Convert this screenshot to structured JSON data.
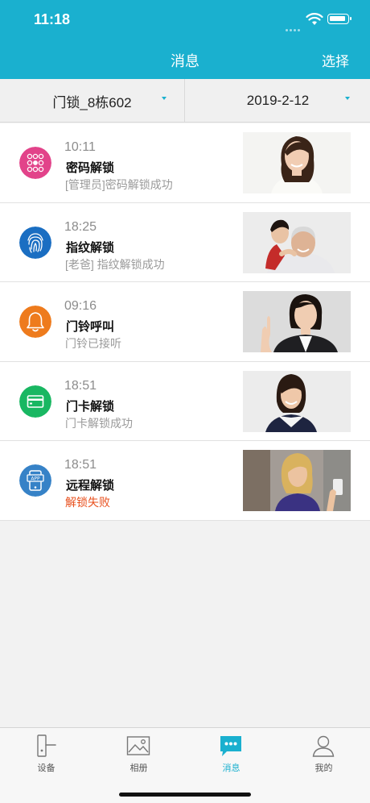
{
  "status_bar": {
    "time": "11:18"
  },
  "nav": {
    "title": "消息",
    "select_label": "选择"
  },
  "filters": {
    "device": "门锁_8栋602",
    "date": "2019-2-12"
  },
  "colors": {
    "accent": "#1ab0cf",
    "fail": "#e8501e"
  },
  "messages": [
    {
      "time": "10:11",
      "type": "密码解锁",
      "desc": "[管理员]密码解锁成功",
      "icon": "keypad-icon",
      "icon_color": "#e2438a",
      "photo": "woman-smiling-photo"
    },
    {
      "time": "18:25",
      "type": "指纹解锁",
      "desc": "[老爸] 指纹解锁成功",
      "icon": "fingerprint-icon",
      "icon_color": "#1a6ec2",
      "photo": "grandfather-child-photo"
    },
    {
      "time": "09:16",
      "type": "门铃呼叫",
      "desc": "门铃已接听",
      "icon": "bell-icon",
      "icon_color": "#ee7b1d",
      "photo": "businesswoman-photo"
    },
    {
      "time": "18:51",
      "type": "门卡解锁",
      "desc": "门卡解锁成功",
      "icon": "card-icon",
      "icon_color": "#19b762",
      "photo": "schoolgirl-photo"
    },
    {
      "time": "18:51",
      "type": "远程解锁",
      "desc": "解锁失败",
      "icon": "app-phone-icon",
      "icon_color": "#3682c7",
      "photo": "woman-phone-photo",
      "failed": true
    }
  ],
  "tabs": [
    {
      "label": "设备",
      "icon": "door-lock-icon"
    },
    {
      "label": "相册",
      "icon": "photo-album-icon"
    },
    {
      "label": "消息",
      "icon": "chat-bubble-icon",
      "active": true
    },
    {
      "label": "我的",
      "icon": "person-icon"
    }
  ]
}
